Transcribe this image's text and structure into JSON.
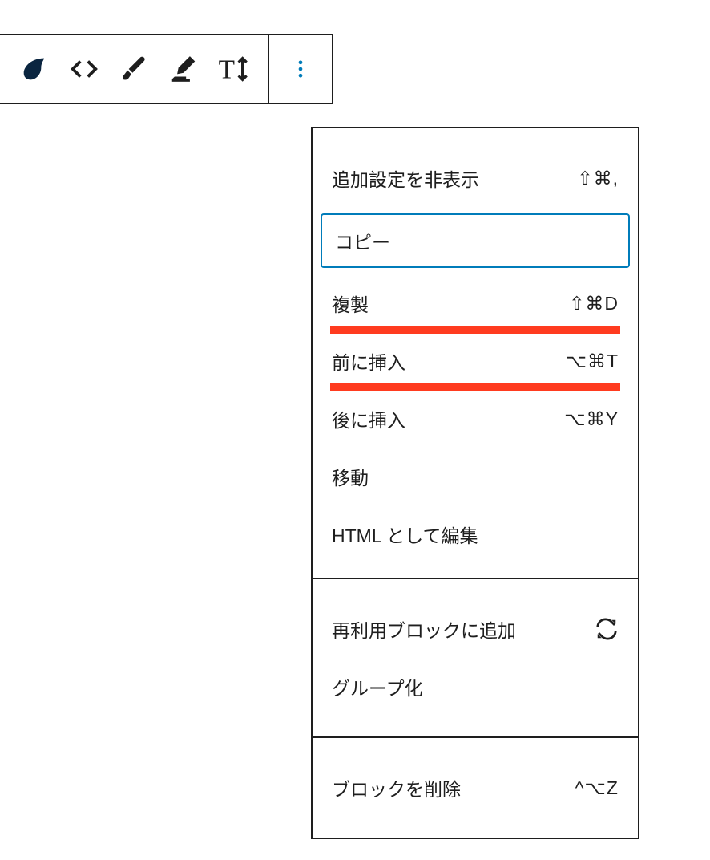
{
  "toolbar": {
    "icons": [
      "blob-icon",
      "code-icon",
      "brush-icon",
      "highlighter-icon",
      "text-height-icon"
    ],
    "more": "more-icon"
  },
  "menu": {
    "section1": [
      {
        "label": "追加設定を非表示",
        "shortcut": "⇧⌘,"
      },
      {
        "label": "コピー",
        "shortcut": "",
        "focused": true
      },
      {
        "label": "複製",
        "shortcut": "⇧⌘D",
        "underline": true
      },
      {
        "label": "前に挿入",
        "shortcut": "⌥⌘T",
        "underline": true
      },
      {
        "label": "後に挿入",
        "shortcut": "⌥⌘Y"
      },
      {
        "label": "移動",
        "shortcut": ""
      },
      {
        "label": "HTML として編集",
        "shortcut": ""
      }
    ],
    "section2": [
      {
        "label": "再利用ブロックに追加",
        "icon": "reuse-icon"
      },
      {
        "label": "グループ化",
        "shortcut": ""
      }
    ],
    "section3": [
      {
        "label": "ブロックを削除",
        "shortcut": "^⌥Z"
      }
    ]
  }
}
